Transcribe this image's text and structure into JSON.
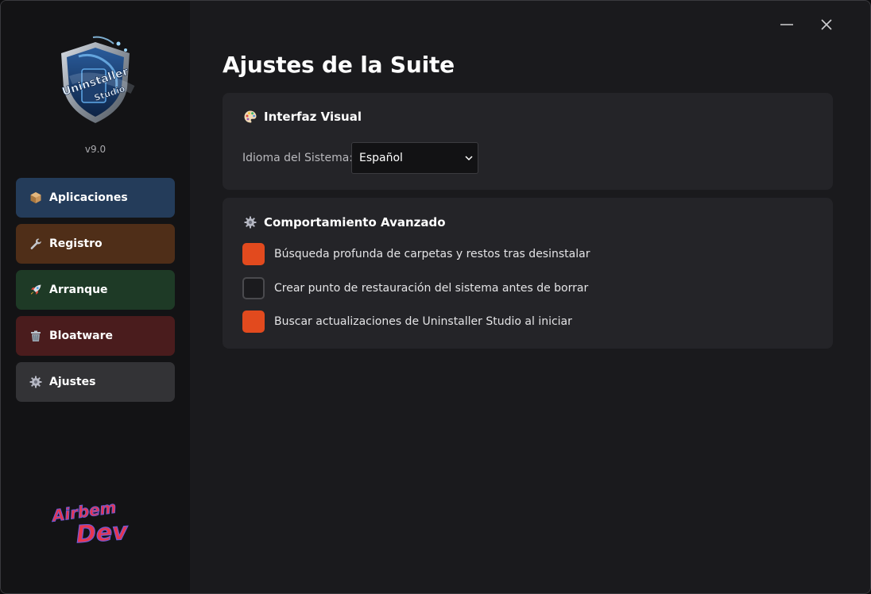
{
  "app": {
    "version": "v9.0"
  },
  "sidebar": {
    "items": [
      {
        "label": "Aplicaciones",
        "icon": "package-icon",
        "bg": "#243c5a"
      },
      {
        "label": "Registro",
        "icon": "wrench-icon",
        "bg": "#4f2e18"
      },
      {
        "label": "Arranque",
        "icon": "rocket-icon",
        "bg": "#1e3a26"
      },
      {
        "label": "Bloatware",
        "icon": "trash-icon",
        "bg": "#4a1c1d"
      },
      {
        "label": "Ajustes",
        "icon": "gear-icon",
        "bg": "#333336"
      }
    ],
    "active_index": 4
  },
  "window_controls": {
    "minimize": "minimize-icon",
    "close": "close-icon"
  },
  "main": {
    "title": "Ajustes de la Suite",
    "visual_section": {
      "title": "Interfaz Visual",
      "icon": "palette-icon",
      "language_label": "Idioma del Sistema:",
      "language_value": "Español"
    },
    "advanced_section": {
      "title": "Comportamiento Avanzado",
      "icon": "gear-icon",
      "options": [
        {
          "label": "Búsqueda profunda de carpetas y restos tras desinstalar",
          "checked": true
        },
        {
          "label": "Crear punto de restauración del sistema antes de borrar",
          "checked": false
        },
        {
          "label": "Buscar actualizaciones de Uninstaller Studio al iniciar",
          "checked": true
        }
      ]
    }
  },
  "colors": {
    "accent": "#e24a1e",
    "sidebar_bg": "#131315",
    "main_bg": "#1a1a1d",
    "card_bg": "#242428"
  }
}
